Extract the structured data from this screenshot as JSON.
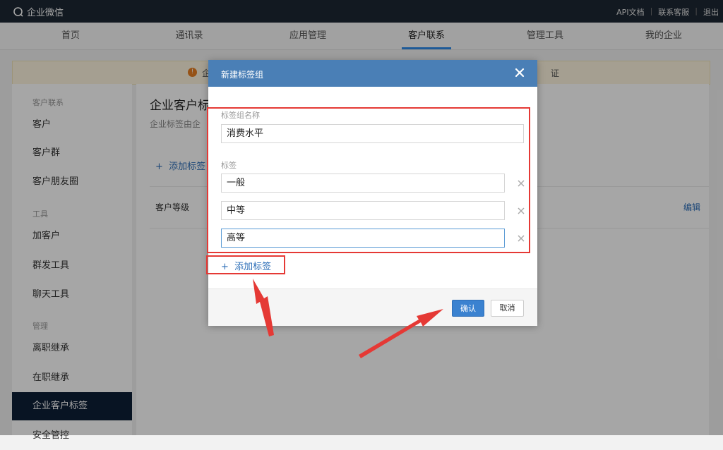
{
  "topbar": {
    "logo_text": "企业微信",
    "links": [
      "API文档",
      "联系客服",
      "退出"
    ],
    "separator": "|"
  },
  "nav": {
    "items": [
      "首页",
      "通讯录",
      "应用管理",
      "客户联系",
      "管理工具",
      "我的企业"
    ],
    "active": "客户联系",
    "accent_color": "#2e8be8"
  },
  "notice": {
    "text_left": "企",
    "text_right": "证"
  },
  "sidebar": {
    "groups": [
      "客户联系",
      "工具",
      "管理"
    ],
    "items": [
      "客户",
      "客户群",
      "客户朋友圈",
      "加客户",
      "群发工具",
      "聊天工具",
      "离职继承",
      "在职继承",
      "企业客户标签",
      "安全管控"
    ],
    "active": "企业客户标签"
  },
  "content": {
    "title": "企业客户标",
    "desc": "企业标签由企",
    "add_tag_label": "添加标签",
    "row_label": "客户等级",
    "row_edit": "编辑"
  },
  "modal": {
    "title": "新建标签组",
    "group_name_label": "标签组名称",
    "group_name_value": "消费水平",
    "tags_label": "标签",
    "tags": [
      "一般",
      "中等",
      "高等"
    ],
    "add_tag_label": "添加标签",
    "ok_label": "确认",
    "cancel_label": "取消",
    "header_color": "#4a7fb6"
  },
  "annotation": {
    "highlight_color": "#e53935"
  }
}
